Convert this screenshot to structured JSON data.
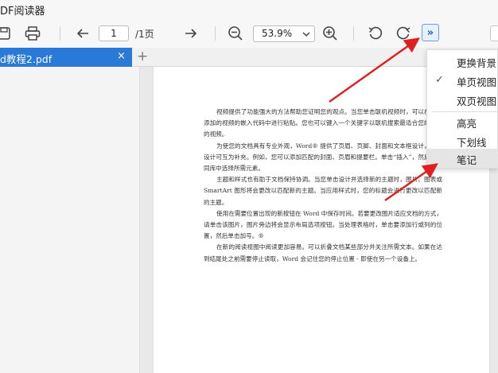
{
  "app": {
    "title": "DF阅读器"
  },
  "toolbar": {
    "page_current": "1",
    "page_total": "/1页",
    "zoom": "53.9%",
    "more_label": "»"
  },
  "tabs": [
    {
      "label": "d教程2.pdf",
      "close": "×"
    }
  ],
  "tab_add": "+",
  "menu": {
    "items": [
      {
        "label": "更换背景"
      },
      {
        "label": "单页视图",
        "checked": true,
        "check": "✓"
      },
      {
        "label": "双页视图"
      },
      {
        "label": "高亮"
      },
      {
        "label": "下划线"
      },
      {
        "label": "笔记"
      }
    ]
  },
  "document": {
    "paragraphs": [
      "视频提供了功能强大的方法帮助您证明您的观点。当您单击联机视频时，可以在想要添加的视频的嵌入代码中进行粘贴。您也可以键入一个关键字以联机搜索最适合您的文档的视频。",
      "为使您的文档具有专业外观，Word® 提供了页眉、页脚、封面和文本框设计，这些设计可互为补充。例如，您可以添加匹配的封面、页眉和提要栏。单击“插入”，然后从不同库中选择所需元素。",
      "主题和样式也有助于文档保持协调。当您单击设计并选择新的主题时，图片、图表或 SmartArt 图形将会更改以匹配新的主题。当应用样式时，您的标题会进行更改以匹配新的主题。",
      "使用在需要位置出现的新按钮在 Word 中保存时间。若要更改图片适应文档的方式，请单击该图片，图片旁边将会显示布局选项按钮。当处理表格时，单击要添加行或列的位置，然后单击加号。®",
      "在新的阅读视图中阅读更加容易。可以折叠文档某些部分并关注所需文本。如果在达到结尾处之前需要停止读取，Word 会记住您的停止位置 - 即使在另一个设备上。"
    ]
  },
  "colors": {
    "accent": "#2979d9",
    "arrow": "#e02020",
    "menu_hover": "#e5e5e5"
  }
}
